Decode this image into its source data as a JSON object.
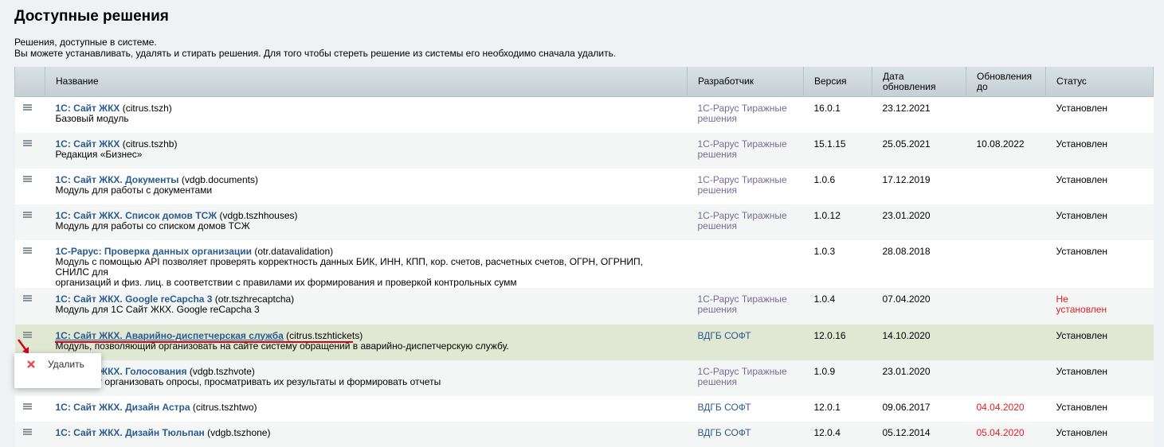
{
  "page": {
    "title": "Доступные решения",
    "desc1": "Решения, доступные в системе.",
    "desc2": "Вы можете устанавливать, удалять и стирать решения. Для того чтобы стереть решение из системы его необходимо сначала удалить."
  },
  "table": {
    "headers": {
      "name": "Название",
      "developer": "Разработчик",
      "version": "Версия",
      "date_l1": "Дата",
      "date_l2": "обновления",
      "until_l1": "Обновления",
      "until_l2": "до",
      "status": "Статус"
    },
    "rows": [
      {
        "title": "1С: Сайт ЖКХ",
        "code": "(citrus.tszh)",
        "desc": [
          "Базовый модуль"
        ],
        "dev1": "1С-Рарус Тиражные",
        "dev2": "решения",
        "version": "16.0.1",
        "date": "23.12.2021",
        "until": "",
        "status1": "Установлен",
        "status2": ""
      },
      {
        "title": "1С: Сайт ЖКХ",
        "code": "(citrus.tszhb)",
        "desc": [
          "Редакция «Бизнес»"
        ],
        "dev1": "1С-Рарус Тиражные",
        "dev2": "решения",
        "version": "15.1.15",
        "date": "25.05.2021",
        "until": "10.08.2022",
        "status1": "Установлен",
        "status2": ""
      },
      {
        "title": "1С: Сайт ЖКХ. Документы",
        "code": "(vdgb.documents)",
        "desc": [
          "Модуль для работы с документами"
        ],
        "dev1": "1С-Рарус Тиражные",
        "dev2": "решения",
        "version": "1.0.6",
        "date": "17.12.2019",
        "until": "",
        "status1": "Установлен",
        "status2": ""
      },
      {
        "title": "1С: Сайт ЖКХ. Список домов ТСЖ",
        "code": "(vdgb.tszhhouses)",
        "desc": [
          "Модуль для работы со списком домов ТСЖ"
        ],
        "dev1": "1С-Рарус Тиражные",
        "dev2": "решения",
        "version": "1.0.12",
        "date": "23.01.2020",
        "until": "",
        "status1": "Установлен",
        "status2": ""
      },
      {
        "title": "1С-Рарус: Проверка данных организации",
        "code": "(otr.datavalidation)",
        "desc": [
          "Модуль с помощью API позволяет проверять корректность данных БИК, ИНН, КПП, кор. счетов, расчетных счетов, ОГРН, ОГРНИП, СНИЛС для",
          "организаций и физ. лиц. в соответствии с правилами их формирования и проверкой контрольных сумм"
        ],
        "dev1": "",
        "dev2": "",
        "version": "1.0.3",
        "date": "28.08.2018",
        "until": "",
        "status1": "Установлен",
        "status2": ""
      },
      {
        "title": "1С: Сайт ЖКХ. Google reCapcha 3",
        "code": "(otr.tszhrecaptcha)",
        "desc": [
          "Модуль для 1С Сайт ЖКХ. Google reCapcha 3"
        ],
        "dev1": "1С-Рарус Тиражные",
        "dev2": "решения",
        "version": "1.0.4",
        "date": "07.04.2020",
        "until": "",
        "status1": "Не",
        "status2": "установлен"
      },
      {
        "title": "1С: Сайт ЖКХ. Аварийно-диспетчерская служба",
        "code": "(citrus.tszhtickets)",
        "desc": [
          "Модуль, позволяющий организовать на сайте систему обращений в аварийно-диспетчерскую службу."
        ],
        "dev1": "ВДГБ СОФТ",
        "dev2": "",
        "version": "12.0.16",
        "date": "14.10.2020",
        "until": "",
        "status1": "Установлен",
        "status2": ""
      },
      {
        "title": "1С: Сайт ЖКХ. Голосования",
        "code": "(vdgb.tszhvote)",
        "desc": [
          "Позволяет организовать опросы, просматривать их результаты и формировать отчеты"
        ],
        "dev1": "1С-Рарус Тиражные",
        "dev2": "решения",
        "version": "1.0.9",
        "date": "23.01.2020",
        "until": "",
        "status1": "Установлен",
        "status2": ""
      },
      {
        "title": "1С: Сайт ЖКХ. Дизайн Астра",
        "code": "(citrus.tszhtwo)",
        "desc": [],
        "dev1": "ВДГБ СОФТ",
        "dev2": "",
        "version": "12.0.1",
        "date": "09.06.2017",
        "until": "04.04.2020",
        "status1": "Установлен",
        "status2": ""
      },
      {
        "title": "1С: Сайт ЖКХ. Дизайн Тюльпан",
        "code": "(vdgb.tszhone)",
        "desc": [],
        "dev1": "ВДГБ СОФТ",
        "dev2": "",
        "version": "12.0.4",
        "date": "05.12.2014",
        "until": "05.04.2020",
        "status1": "Установлен",
        "status2": ""
      }
    ]
  },
  "context_menu": {
    "delete_label": "Удалить",
    "icon": "delete-x-icon"
  },
  "colors": {
    "link": "#2b5c8f",
    "developer": "#7a6a98",
    "highlight": "#e0e7d2",
    "red": "#e02020"
  }
}
